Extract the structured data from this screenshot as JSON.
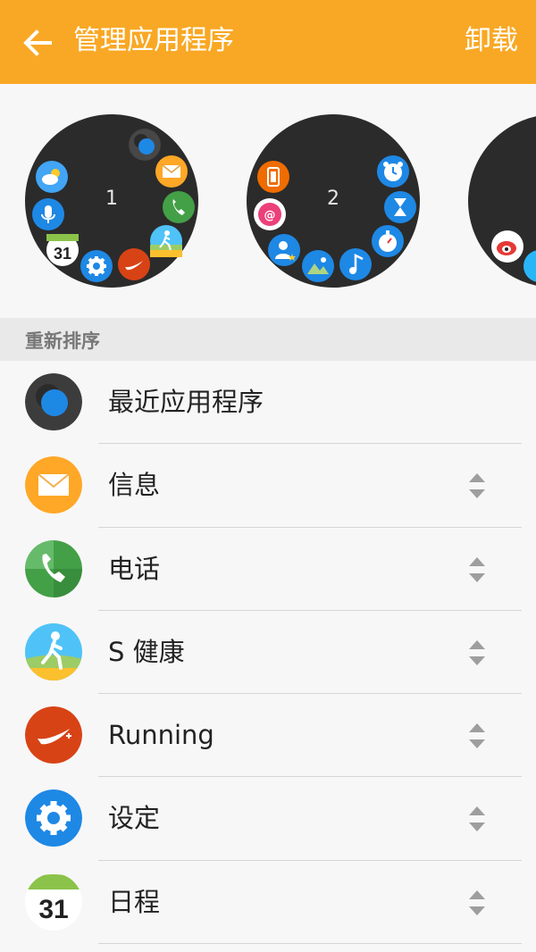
{
  "header": {
    "title": "管理应用程序",
    "uninstall_label": "卸载"
  },
  "pages": [
    {
      "number": "1",
      "apps": [
        "recent-apps",
        "messages",
        "phone",
        "s-health",
        "running",
        "settings",
        "calendar",
        "voice",
        "weather"
      ]
    },
    {
      "number": "2",
      "apps": [
        "alarm",
        "timer",
        "stopwatch",
        "music",
        "gallery",
        "contacts",
        "email",
        "gear-manager"
      ]
    },
    {
      "number": "",
      "apps": [
        "weibo"
      ]
    }
  ],
  "calendar_day": "31",
  "section": {
    "title": "重新排序"
  },
  "apps": [
    {
      "label": "最近应用程序",
      "icon": "recent-apps-icon",
      "reorderable": false
    },
    {
      "label": "信息",
      "icon": "messages-icon",
      "reorderable": true
    },
    {
      "label": "电话",
      "icon": "phone-icon",
      "reorderable": true
    },
    {
      "label": "S 健康",
      "icon": "s-health-icon",
      "reorderable": true
    },
    {
      "label": "Running",
      "icon": "running-icon",
      "reorderable": true
    },
    {
      "label": "设定",
      "icon": "settings-icon",
      "reorderable": true
    },
    {
      "label": "日程",
      "icon": "calendar-icon",
      "reorderable": true
    }
  ],
  "colors": {
    "appbar": "#f9a825",
    "background": "#f7f7f7",
    "section_header": "#e9e9e9"
  }
}
